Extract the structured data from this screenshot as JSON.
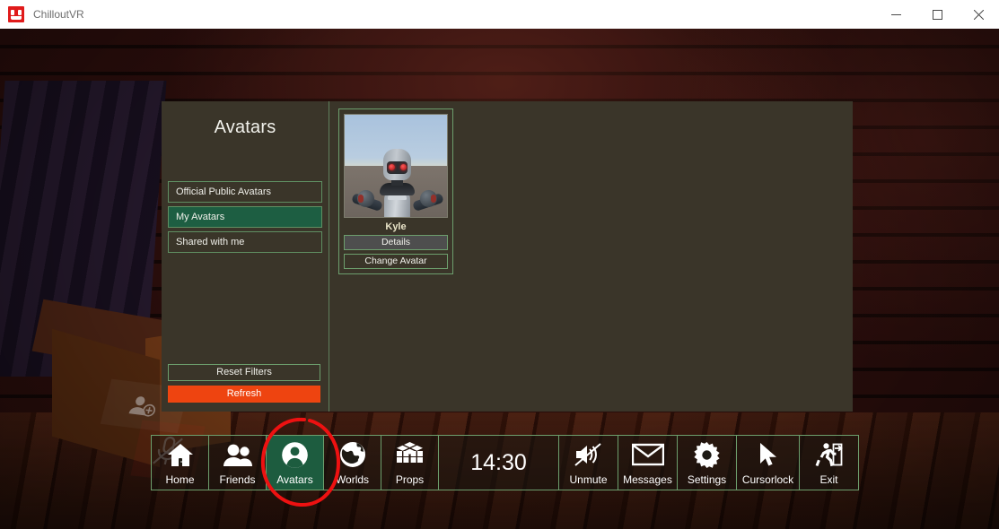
{
  "window": {
    "app_title": "ChilloutVR",
    "app_icon": "chilloutvr-logo-icon",
    "minimize_label": "minimize-icon",
    "maximize_label": "maximize-icon",
    "close_label": "close-icon"
  },
  "menu": {
    "title": "Avatars",
    "filters": [
      {
        "label": "Official Public Avatars",
        "active": false
      },
      {
        "label": "My Avatars",
        "active": true
      },
      {
        "label": "Shared with me",
        "active": false
      }
    ],
    "reset_filters_label": "Reset Filters",
    "refresh_label": "Refresh",
    "avatars": [
      {
        "name": "Kyle",
        "details_label": "Details",
        "change_label": "Change Avatar",
        "thumbnail": "robot-avatar-thumbnail"
      }
    ]
  },
  "quickbar": {
    "items": [
      {
        "id": "home",
        "label": "Home",
        "icon": "house-icon",
        "active": false
      },
      {
        "id": "friends",
        "label": "Friends",
        "icon": "people-icon",
        "active": false
      },
      {
        "id": "avatars",
        "label": "Avatars",
        "icon": "person-circle-icon",
        "active": true
      },
      {
        "id": "worlds",
        "label": "Worlds",
        "icon": "globe-icon",
        "active": false
      },
      {
        "id": "props",
        "label": "Props",
        "icon": "rubiks-cube-icon",
        "active": false
      }
    ],
    "clock": "14:30",
    "right_items": [
      {
        "id": "unmute",
        "label": "Unmute",
        "icon": "speaker-muted-icon"
      },
      {
        "id": "messages",
        "label": "Messages",
        "icon": "envelope-icon"
      },
      {
        "id": "settings",
        "label": "Settings",
        "icon": "gear-icon"
      },
      {
        "id": "cursorlock",
        "label": "Cursorlock",
        "icon": "mouse-cursor-icon"
      },
      {
        "id": "exit",
        "label": "Exit",
        "icon": "exit-door-icon"
      }
    ]
  },
  "annotation": {
    "shape": "red-ellipse-highlight",
    "color": "#ee1111",
    "targets": "avatars-quickbar-button"
  },
  "colors": {
    "panel_background": "#3a3529",
    "accent_green": "#1d5e42",
    "border_green": "#6d9f6d",
    "refresh_orange": "#ee4410",
    "titlebar": "#ffffff"
  }
}
